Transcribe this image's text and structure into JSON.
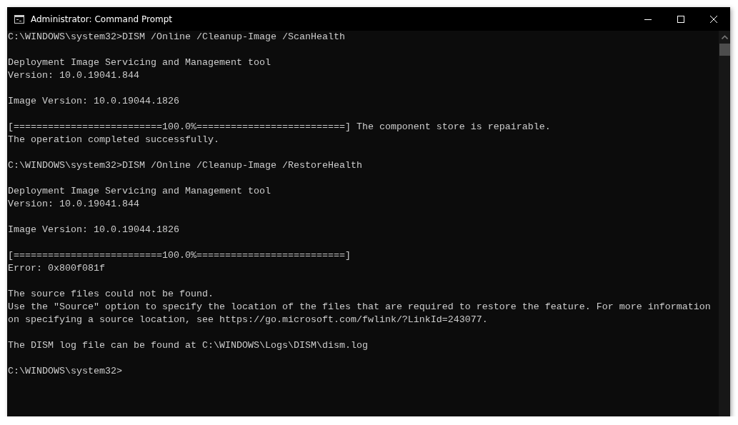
{
  "window": {
    "title": "Administrator: Command Prompt"
  },
  "console": {
    "blocks": [
      [
        "C:\\WINDOWS\\system32>DISM /Online /Cleanup-Image /ScanHealth"
      ],
      [
        "Deployment Image Servicing and Management tool",
        "Version: 10.0.19041.844"
      ],
      [
        "Image Version: 10.0.19044.1826"
      ],
      [
        "[==========================100.0%==========================] The component store is repairable.",
        "The operation completed successfully."
      ],
      [
        "C:\\WINDOWS\\system32>DISM /Online /Cleanup-Image /RestoreHealth"
      ],
      [
        "Deployment Image Servicing and Management tool",
        "Version: 10.0.19041.844"
      ],
      [
        "Image Version: 10.0.19044.1826"
      ],
      [
        "[==========================100.0%==========================]",
        "Error: 0x800f081f"
      ],
      [
        "The source files could not be found.",
        "Use the \"Source\" option to specify the location of the files that are required to restore the feature. For more information",
        "on specifying a source location, see https://go.microsoft.com/fwlink/?LinkId=243077."
      ],
      [
        "The DISM log file can be found at C:\\WINDOWS\\Logs\\DISM\\dism.log"
      ],
      [
        "C:\\WINDOWS\\system32>"
      ]
    ]
  }
}
